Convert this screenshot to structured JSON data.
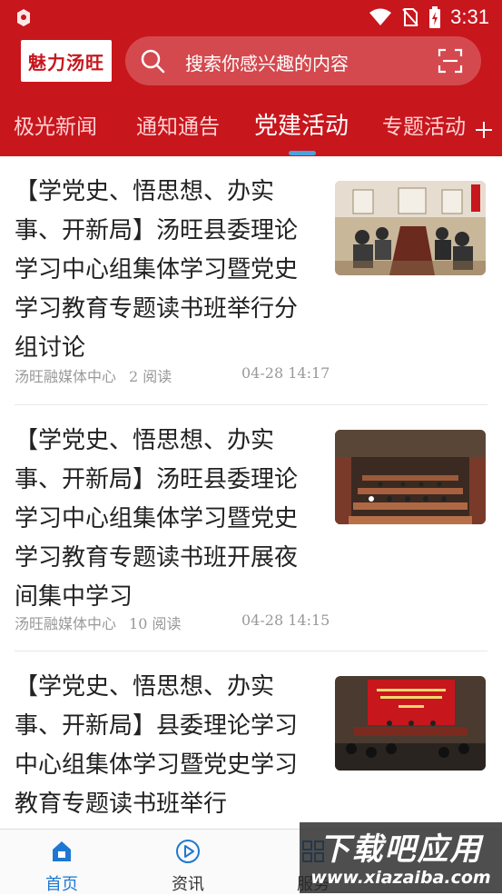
{
  "status_bar": {
    "time": "3:31"
  },
  "header": {
    "logo_text": "魅力汤旺",
    "search_placeholder": "搜索你感兴趣的内容"
  },
  "tabs": [
    {
      "label": "极光新闻",
      "active": false
    },
    {
      "label": "通知通告",
      "active": false
    },
    {
      "label": "党建活动",
      "active": true
    },
    {
      "label": "专题活动",
      "active": false
    }
  ],
  "articles": [
    {
      "title": "【学党史、悟思想、办实事、开新局】汤旺县委理论学习中心组集体学习暨党史学习教育专题读书班举行分组讨论",
      "source": "汤旺融媒体中心",
      "reads": "2 阅读",
      "time": "04-28 14:17"
    },
    {
      "title": "【学党史、悟思想、办实事、开新局】汤旺县委理论学习中心组集体学习暨党史学习教育专题读书班开展夜间集中学习",
      "source": "汤旺融媒体中心",
      "reads": "10 阅读",
      "time": "04-28 14:15"
    },
    {
      "title": "【学党史、悟思想、办实事、开新局】县委理论学习中心组集体学习暨党史学习教育专题读书班举行",
      "source": "",
      "reads": "",
      "time": ""
    }
  ],
  "bottom_nav": [
    {
      "label": "首页",
      "icon": "home-icon",
      "active": true
    },
    {
      "label": "资讯",
      "icon": "play-circle-icon",
      "active": false
    },
    {
      "label": "服务",
      "icon": "grid-icon",
      "active": false
    }
  ],
  "watermark": {
    "title": "下载吧应用",
    "url": "www.xiazaiba.com"
  },
  "colors": {
    "brand_red": "#c8161d",
    "accent_blue": "#1e78d2",
    "indicator_blue": "#4aa3df"
  }
}
